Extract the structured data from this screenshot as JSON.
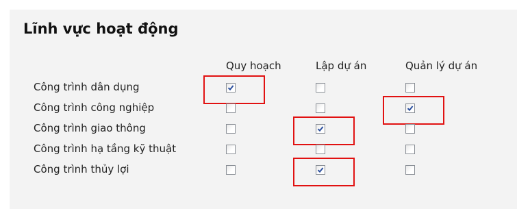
{
  "section": {
    "title": "Lĩnh vực hoạt động"
  },
  "columns": [
    "Quy hoạch",
    "Lập dự án",
    "Quản lý dự án"
  ],
  "rows": [
    {
      "label": "Công trình dân dụng",
      "checked": [
        true,
        false,
        false
      ]
    },
    {
      "label": "Công trình công nghiệp",
      "checked": [
        false,
        false,
        true
      ]
    },
    {
      "label": "Công trình giao thông",
      "checked": [
        false,
        true,
        false
      ]
    },
    {
      "label": "Công trình hạ tầng kỹ thuật",
      "checked": [
        false,
        false,
        false
      ]
    },
    {
      "label": "Công trình thủy lợi",
      "checked": [
        false,
        true,
        false
      ]
    }
  ],
  "colors": {
    "highlight": "#e11111",
    "check": "#2b4f9e",
    "panel_bg": "#f3f3f3"
  }
}
